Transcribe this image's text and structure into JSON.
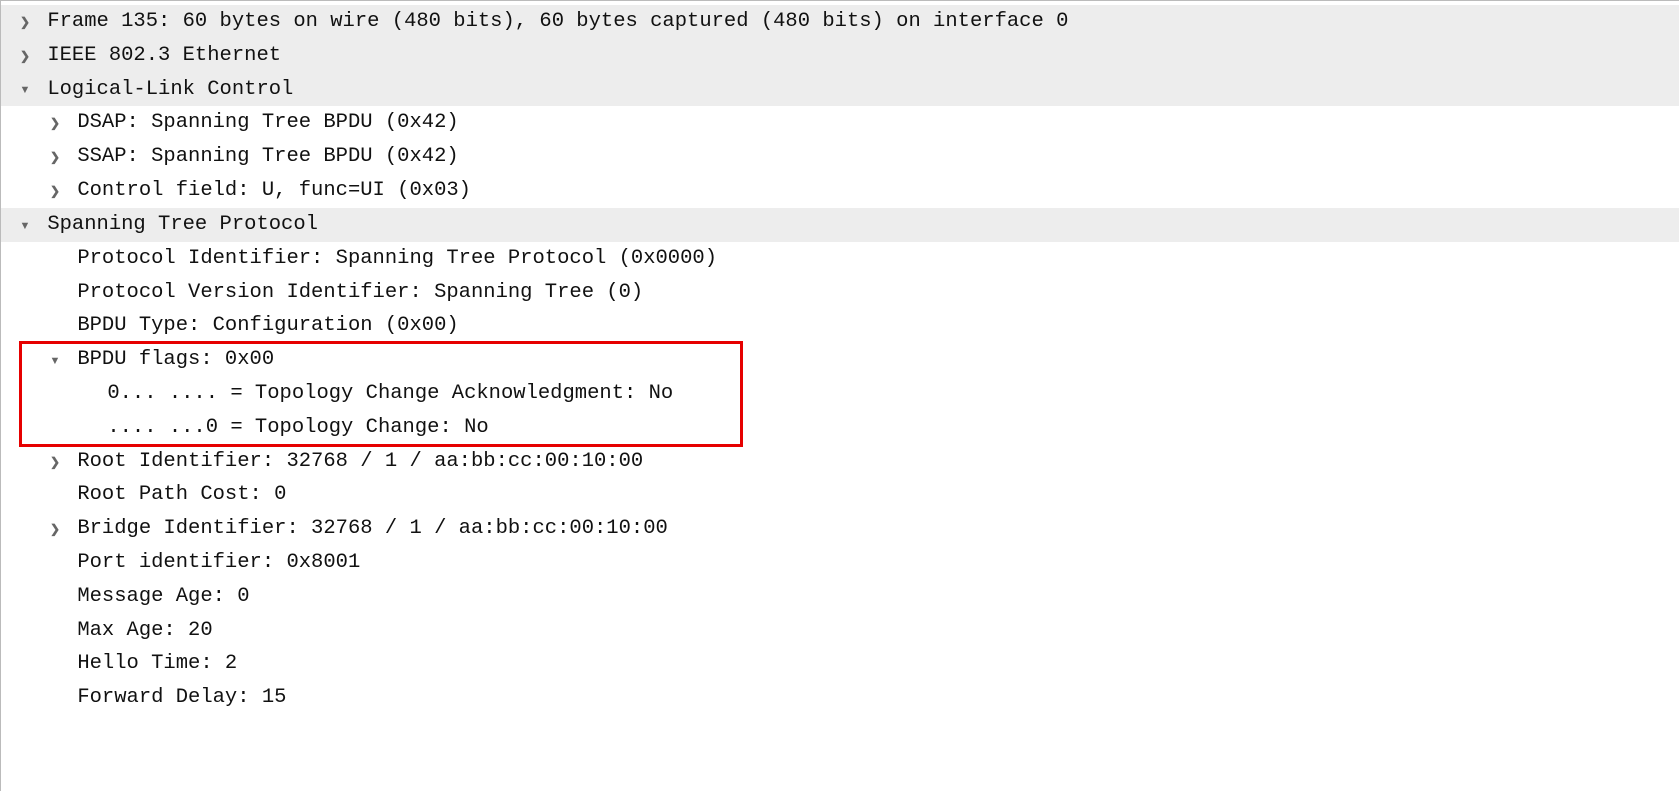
{
  "lines": [
    {
      "indent": 0,
      "toggle": "closed",
      "shaded": true,
      "text": "Frame 135: 60 bytes on wire (480 bits), 60 bytes captured (480 bits) on interface 0"
    },
    {
      "indent": 0,
      "toggle": "closed",
      "shaded": true,
      "text": "IEEE 802.3 Ethernet"
    },
    {
      "indent": 0,
      "toggle": "open",
      "shaded": true,
      "text": "Logical-Link Control"
    },
    {
      "indent": 1,
      "toggle": "closed",
      "shaded": false,
      "text": "DSAP: Spanning Tree BPDU (0x42)"
    },
    {
      "indent": 1,
      "toggle": "closed",
      "shaded": false,
      "text": "SSAP: Spanning Tree BPDU (0x42)"
    },
    {
      "indent": 1,
      "toggle": "closed",
      "shaded": false,
      "text": "Control field: U, func=UI (0x03)"
    },
    {
      "indent": 0,
      "toggle": "open",
      "shaded": true,
      "text": "Spanning Tree Protocol"
    },
    {
      "indent": 1,
      "toggle": "none",
      "shaded": false,
      "text": "Protocol Identifier: Spanning Tree Protocol (0x0000)"
    },
    {
      "indent": 1,
      "toggle": "none",
      "shaded": false,
      "text": "Protocol Version Identifier: Spanning Tree (0)"
    },
    {
      "indent": 1,
      "toggle": "none",
      "shaded": false,
      "text": "BPDU Type: Configuration (0x00)"
    },
    {
      "indent": 1,
      "toggle": "open",
      "shaded": false,
      "text": "BPDU flags: 0x00"
    },
    {
      "indent": 2,
      "toggle": "none",
      "shaded": false,
      "text": "0... .... = Topology Change Acknowledgment: No"
    },
    {
      "indent": 2,
      "toggle": "none",
      "shaded": false,
      "text": ".... ...0 = Topology Change: No"
    },
    {
      "indent": 1,
      "toggle": "closed",
      "shaded": false,
      "text": "Root Identifier: 32768 / 1 / aa:bb:cc:00:10:00"
    },
    {
      "indent": 1,
      "toggle": "none",
      "shaded": false,
      "text": "Root Path Cost: 0"
    },
    {
      "indent": 1,
      "toggle": "closed",
      "shaded": false,
      "text": "Bridge Identifier: 32768 / 1 / aa:bb:cc:00:10:00"
    },
    {
      "indent": 1,
      "toggle": "none",
      "shaded": false,
      "text": "Port identifier: 0x8001"
    },
    {
      "indent": 1,
      "toggle": "none",
      "shaded": false,
      "text": "Message Age: 0"
    },
    {
      "indent": 1,
      "toggle": "none",
      "shaded": false,
      "text": "Max Age: 20"
    },
    {
      "indent": 1,
      "toggle": "none",
      "shaded": false,
      "text": "Hello Time: 2"
    },
    {
      "indent": 1,
      "toggle": "none",
      "shaded": false,
      "text": "Forward Delay: 15"
    }
  ],
  "highlight": {
    "fromLine": 10,
    "toLine": 12
  }
}
